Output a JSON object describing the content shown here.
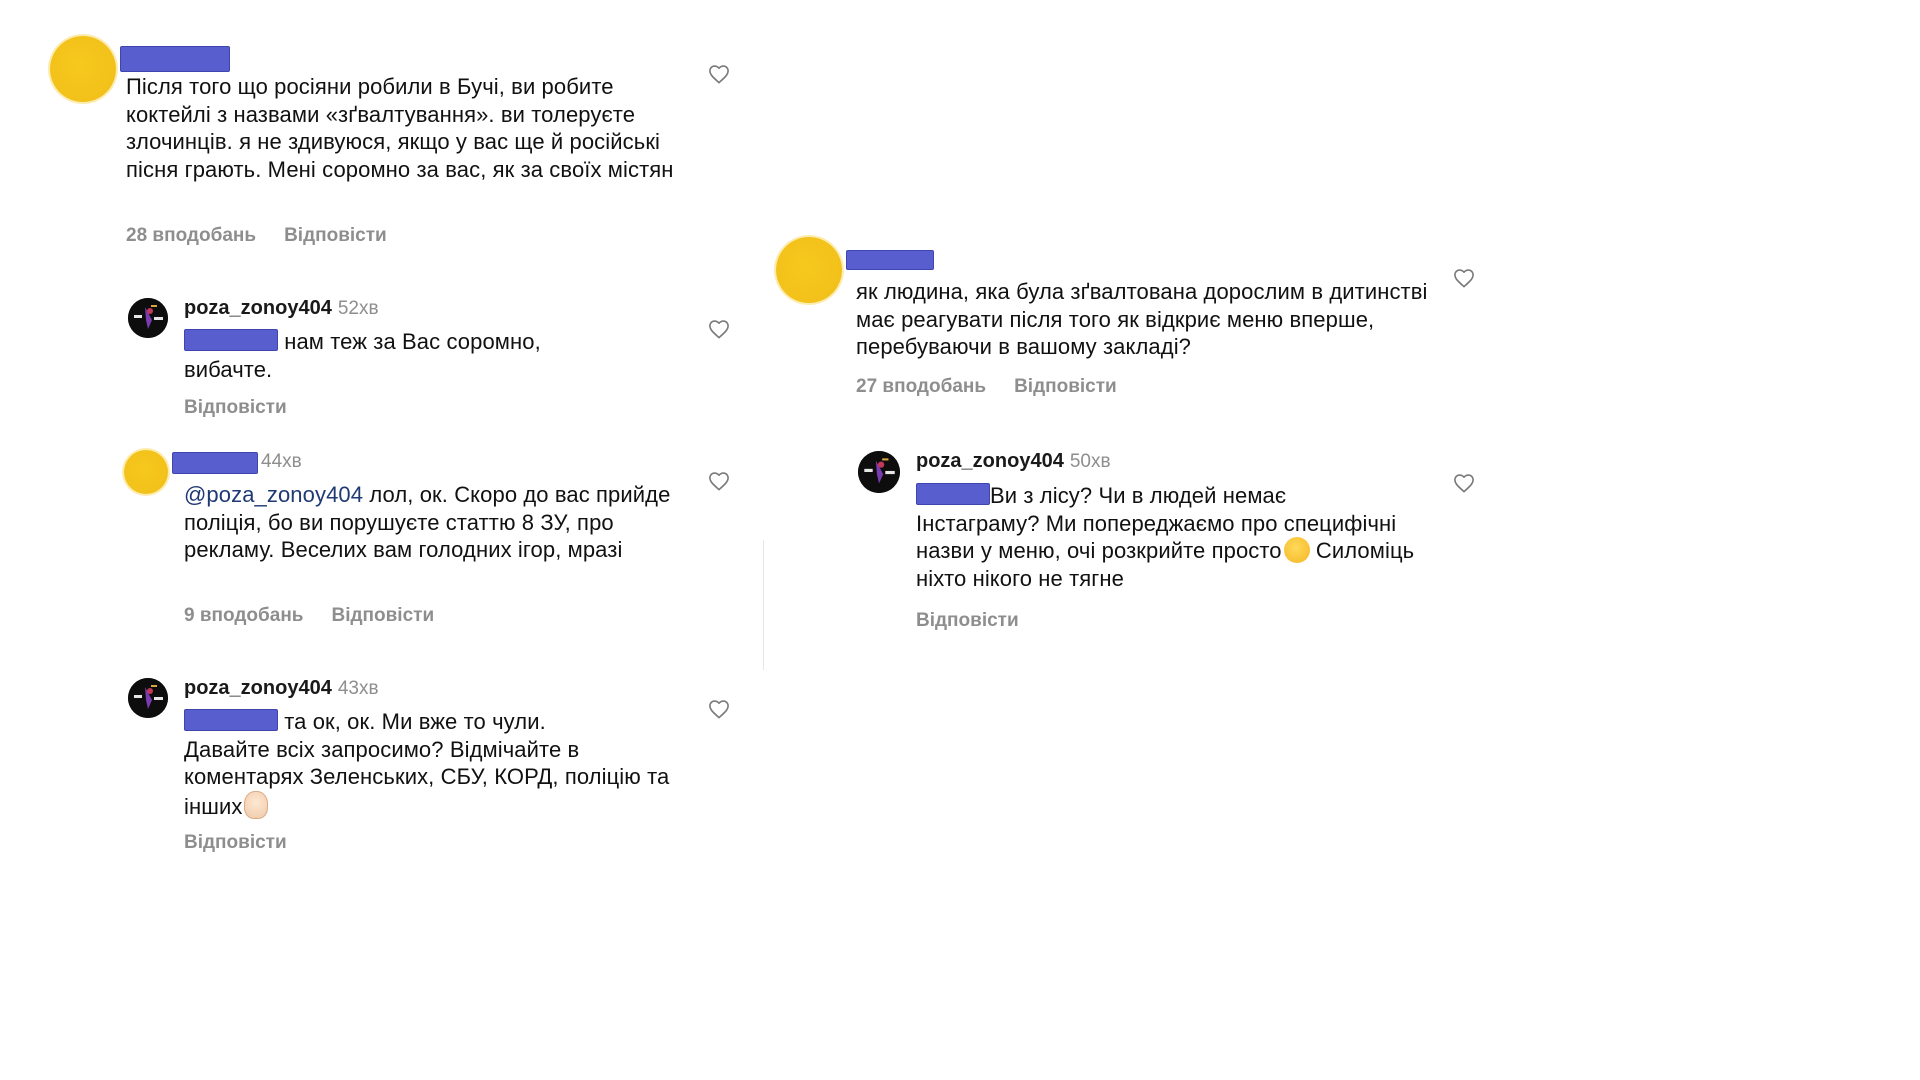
{
  "left": {
    "c1": {
      "text": "Після того що росіяни робили в Бучі, ви робите коктейлі з назвами «зґвалтування». ви толеруєте злочинців. я не здивуюся, якщо у вас ще й російські пісня грають. Мені соромно за вас, як за своїх містян",
      "likes": "28 вподобань",
      "reply": "Відповісти"
    },
    "c2": {
      "username": "poza_zonoy404",
      "time": "52хв",
      "text_suffix": "нам теж за Вас соромно,",
      "text_line2": "вибачте.",
      "reply": "Відповісти"
    },
    "c3": {
      "time": "44хв",
      "mention": "@poza_zonoy404",
      "text": "лол, ок. Скоро до вас прийде поліція, бо ви порушуєте статтю 8 ЗУ, про рекламу. Веселих вам голодних ігор, мразі",
      "likes": "9 вподобань",
      "reply": "Відповісти"
    },
    "c4": {
      "username": "poza_zonoy404",
      "time": "43хв",
      "text_suffix": "та ок, ок. Ми вже то чули.",
      "text_rest": "Давайте всіх запросимо? Відмічайте в коментарях Зеленських, СБУ, КОРД, поліцію та інших",
      "reply": "Відповісти"
    }
  },
  "right": {
    "c1": {
      "text": "як людина, яка була зґвалтована дорослим в дитинстві має реагувати після того як відкриє меню вперше, перебуваючи в вашому закладі?",
      "likes": "27 вподобань",
      "reply": "Відповісти"
    },
    "c2": {
      "username": "poza_zonoy404",
      "time": "50хв",
      "text_suffix": "Ви з лісу? Чи в людей немає",
      "text_mid": "Інстаграму? Ми попереджаємо про специфічні назви у меню, очі розкрийте просто",
      "text_end": "Силоміць ніхто нікого не тягне",
      "reply": "Відповісти"
    }
  },
  "icons": {
    "like": "heart-outline-icon",
    "avatar_brand": "poza-zonoy-logo",
    "emoji_think": "thinking-face-emoji",
    "emoji_ok": "ok-hand-emoji"
  },
  "colors": {
    "redaction": "#4a51c9",
    "avatar_placeholder": "#f3c21b",
    "meta_gray": "#8e8e8e",
    "mention": "#1f3a73"
  }
}
